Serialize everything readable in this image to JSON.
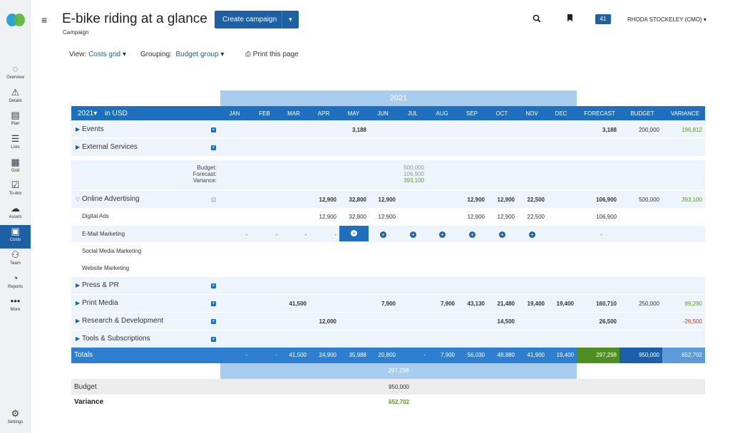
{
  "app": {
    "title": "E-bike riding at a glance",
    "subtitle": "Campaign"
  },
  "header": {
    "create_label": "Create campaign",
    "badge": "41",
    "user": "RHODA STOCKELEY (CMO)"
  },
  "viewbar": {
    "view_label": "View:",
    "view_value": "Costs grid",
    "grouping_label": "Grouping:",
    "grouping_value": "Budget group",
    "print_label": "Print this page"
  },
  "nav": [
    {
      "icon": "overview-icon",
      "glyph": "◌",
      "label": "Overview"
    },
    {
      "icon": "details-icon",
      "glyph": "⚠",
      "label": "Details"
    },
    {
      "icon": "plan-icon",
      "glyph": "▤",
      "label": "Plan"
    },
    {
      "icon": "lists-icon",
      "glyph": "☰",
      "label": "Lists"
    },
    {
      "icon": "grid-icon",
      "glyph": "▦",
      "label": "Grid"
    },
    {
      "icon": "todos-icon",
      "glyph": "☑",
      "label": "To-dos"
    },
    {
      "icon": "assets-icon",
      "glyph": "☁",
      "label": "Assets"
    },
    {
      "icon": "costs-icon",
      "glyph": "▣",
      "label": "Costs"
    },
    {
      "icon": "team-icon",
      "glyph": "⚇",
      "label": "Team"
    },
    {
      "icon": "reports-icon",
      "glyph": "◔",
      "label": "Reports"
    },
    {
      "icon": "more-icon",
      "glyph": "•••",
      "label": "More"
    }
  ],
  "settings": {
    "icon": "settings-icon",
    "glyph": "⚙",
    "label": "Settings"
  },
  "grid": {
    "year": "2021",
    "year_select": "2021▾",
    "currency": "in USD",
    "months": [
      "JAN",
      "FEB",
      "MAR",
      "APR",
      "MAY",
      "JUN",
      "JUL",
      "AUG",
      "SEP",
      "OCT",
      "NOV",
      "DEC"
    ],
    "summary_cols": [
      "FORECAST",
      "BUDGET",
      "VARIANCE"
    ],
    "rows": {
      "events": {
        "label": "Events",
        "may": "3,188",
        "forecast": "3,188",
        "budget": "200,000",
        "variance": "196,812"
      },
      "external": {
        "label": "External Services"
      },
      "tooltip": {
        "budget_lbl": "Budget:",
        "forecast_lbl": "Forecast:",
        "variance_lbl": "Variance:",
        "budget": "500,000",
        "forecast": "106,900",
        "variance": "393,100"
      },
      "online": {
        "label": "Online Advertising",
        "apr": "12,900",
        "may": "32,800",
        "jun": "12,900",
        "sep": "12,900",
        "oct": "12,900",
        "nov": "22,500",
        "forecast": "106,900",
        "budget": "500,000",
        "variance": "393,100"
      },
      "digital": {
        "label": "Digital Ads",
        "apr": "12,900",
        "may": "32,800",
        "jun": "12,900",
        "sep": "12,900",
        "oct": "12,900",
        "nov": "22,500",
        "forecast": "106,900"
      },
      "email": {
        "label": "E-Mail Marketing",
        "dash": "-",
        "forecast": "-"
      },
      "social": {
        "label": "Social Media Marketing"
      },
      "website": {
        "label": "Website Marketing"
      },
      "press": {
        "label": "Press & PR"
      },
      "print": {
        "label": "Print Media",
        "mar": "41,500",
        "jun": "7,900",
        "aug": "7,900",
        "sep": "43,130",
        "oct": "21,480",
        "nov": "19,400",
        "dec": "19,400",
        "forecast": "160,710",
        "budget": "250,000",
        "variance": "89,290"
      },
      "research": {
        "label": "Research & Development",
        "apr": "12,000",
        "oct": "14,500",
        "forecast": "26,500",
        "variance": "-26,500"
      },
      "tools": {
        "label": "Tools & Subscriptions"
      }
    },
    "totals": {
      "label": "Totals",
      "jan": "-",
      "feb": "-",
      "mar": "41,500",
      "apr": "24,900",
      "may": "35,988",
      "jun": "20,800",
      "jul": "-",
      "aug": "7,900",
      "sep": "56,030",
      "oct": "48,880",
      "nov": "41,900",
      "dec": "19,400",
      "forecast": "297,298",
      "budget": "950,000",
      "variance": "652,702",
      "sum": "297,298"
    },
    "budget_row": {
      "label": "Budget",
      "value": "950,000"
    },
    "variance_row": {
      "label": "Variance",
      "value": "652,702"
    }
  }
}
